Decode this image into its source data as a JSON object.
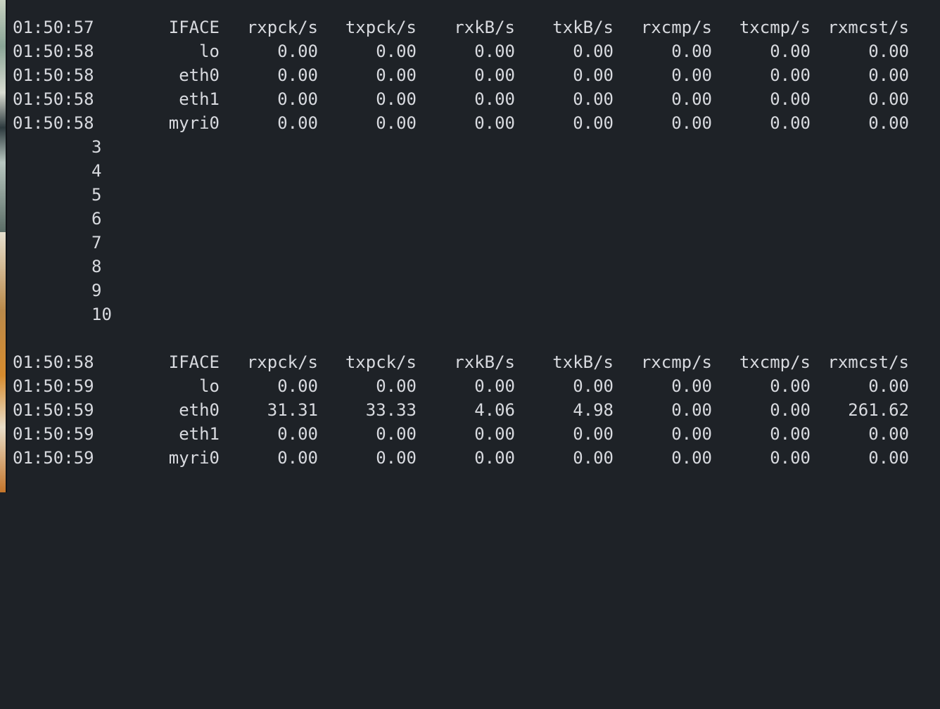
{
  "terminal": {
    "block1": {
      "header": {
        "time": "01:50:57",
        "iface": "IFACE",
        "rxpck": "rxpck/s",
        "txpck": "txpck/s",
        "rxkb": "rxkB/s",
        "txkb": "txkB/s",
        "rxcmp": "rxcmp/s",
        "txcmp": "txcmp/s",
        "rxmcst": "rxmcst/s"
      },
      "rows": [
        {
          "time": "01:50:58",
          "iface": "lo",
          "rxpck": "0.00",
          "txpck": "0.00",
          "rxkb": "0.00",
          "txkb": "0.00",
          "rxcmp": "0.00",
          "txcmp": "0.00",
          "rxmcst": "0.00"
        },
        {
          "time": "01:50:58",
          "iface": "eth0",
          "rxpck": "0.00",
          "txpck": "0.00",
          "rxkb": "0.00",
          "txkb": "0.00",
          "rxcmp": "0.00",
          "txcmp": "0.00",
          "rxmcst": "0.00"
        },
        {
          "time": "01:50:58",
          "iface": "eth1",
          "rxpck": "0.00",
          "txpck": "0.00",
          "rxkb": "0.00",
          "txkb": "0.00",
          "rxcmp": "0.00",
          "txcmp": "0.00",
          "rxmcst": "0.00"
        },
        {
          "time": "01:50:58",
          "iface": "myri0",
          "rxpck": "0.00",
          "txpck": "0.00",
          "rxkb": "0.00",
          "txkb": "0.00",
          "rxcmp": "0.00",
          "txcmp": "0.00",
          "rxmcst": "0.00"
        }
      ]
    },
    "line_numbers": [
      "3",
      "4",
      "5",
      "6",
      "7",
      "8",
      "9",
      "10"
    ],
    "block2": {
      "header": {
        "time": "01:50:58",
        "iface": "IFACE",
        "rxpck": "rxpck/s",
        "txpck": "txpck/s",
        "rxkb": "rxkB/s",
        "txkb": "txkB/s",
        "rxcmp": "rxcmp/s",
        "txcmp": "txcmp/s",
        "rxmcst": "rxmcst/s"
      },
      "rows": [
        {
          "time": "01:50:59",
          "iface": "lo",
          "rxpck": "0.00",
          "txpck": "0.00",
          "rxkb": "0.00",
          "txkb": "0.00",
          "rxcmp": "0.00",
          "txcmp": "0.00",
          "rxmcst": "0.00"
        },
        {
          "time": "01:50:59",
          "iface": "eth0",
          "rxpck": "31.31",
          "txpck": "33.33",
          "rxkb": "4.06",
          "txkb": "4.98",
          "rxcmp": "0.00",
          "txcmp": "0.00",
          "rxmcst": "261.62"
        },
        {
          "time": "01:50:59",
          "iface": "eth1",
          "rxpck": "0.00",
          "txpck": "0.00",
          "rxkb": "0.00",
          "txkb": "0.00",
          "rxcmp": "0.00",
          "txcmp": "0.00",
          "rxmcst": "0.00"
        },
        {
          "time": "01:50:59",
          "iface": "myri0",
          "rxpck": "0.00",
          "txpck": "0.00",
          "rxkb": "0.00",
          "txkb": "0.00",
          "rxcmp": "0.00",
          "txcmp": "0.00",
          "rxmcst": "0.00"
        }
      ]
    }
  }
}
